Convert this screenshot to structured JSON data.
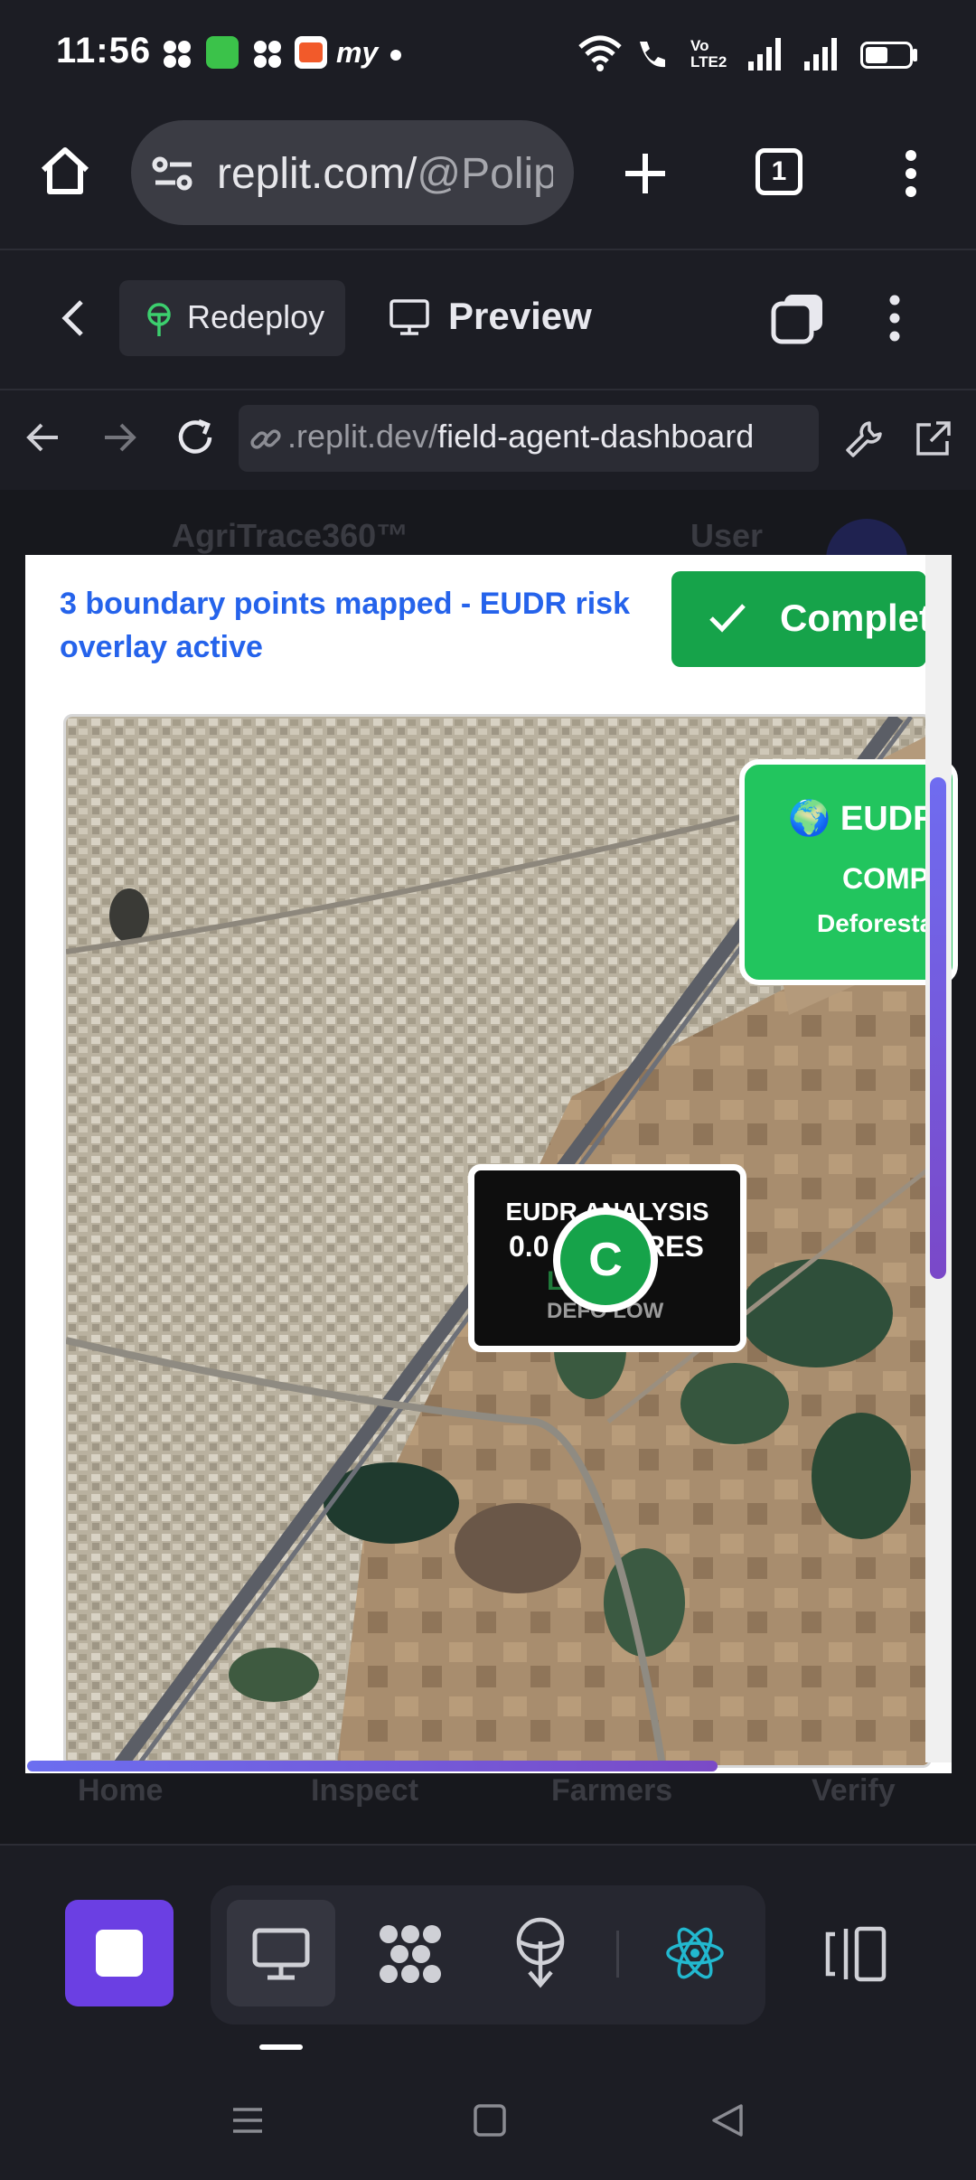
{
  "status_bar": {
    "time": "11:56",
    "signal_label": "Vo LTE2",
    "icons": [
      "pinwheel-icon",
      "app-icon",
      "pinwheel-icon",
      "gallery-icon",
      "my-icon",
      "dot-icon",
      "wifi-icon",
      "wifi-call-icon",
      "volte-icon",
      "signal-icon",
      "signal-icon",
      "battery-icon"
    ]
  },
  "browser": {
    "url_host": "replit.com/",
    "url_path": "@Polip",
    "tab_count": "1"
  },
  "replit_toolbar": {
    "redeploy_label": "Redeploy",
    "preview_label": "Preview"
  },
  "preview_bar": {
    "address_prefix": ".replit.dev/",
    "address_path": "field-agent-dashboard"
  },
  "underlay": {
    "brand": "AgriTrace360™",
    "user_label": "User",
    "nav": [
      "Home",
      "Inspect",
      "Farmers",
      "Verify"
    ]
  },
  "modal": {
    "message": "3 boundary points mapped - EUDR risk overlay active",
    "complete_label": "Complete",
    "eudr_card": {
      "line1": "🌍 EUDR",
      "line2": "COMP",
      "line3": "Deforesta"
    },
    "analysis_card": {
      "title": "EUDR ANALYSIS",
      "area_left": "0.0",
      "area_right": "RES",
      "risk": "L    K",
      "defor": "DEFO   LOW"
    },
    "marker_letter": "C"
  },
  "colors": {
    "accent_purple": "#6b3fe3",
    "success_green": "#16a34a",
    "link_blue": "#2563eb",
    "react_cyan": "#22b8cf"
  }
}
